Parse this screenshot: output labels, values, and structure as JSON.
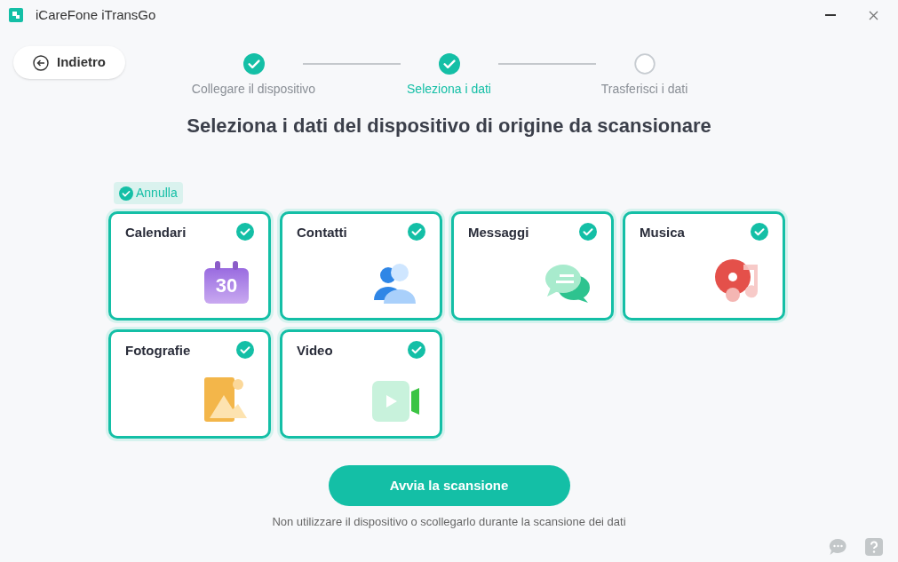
{
  "window": {
    "title": "iCareFone iTransGo"
  },
  "back_button": {
    "label": "Indietro"
  },
  "steps": [
    {
      "label": "Collegare il dispositivo",
      "done": true,
      "selected": false
    },
    {
      "label": "Seleziona i dati",
      "done": true,
      "selected": true
    },
    {
      "label": "Trasferisci i dati",
      "done": false,
      "selected": false
    }
  ],
  "heading": "Seleziona i dati del dispositivo di origine da scansionare",
  "toggle_all": {
    "label": "Annulla",
    "checked": true
  },
  "categories": [
    {
      "label": "Calendari",
      "kind": "calendar",
      "checked": true,
      "icon_text": "30"
    },
    {
      "label": "Contatti",
      "kind": "contacts",
      "checked": true
    },
    {
      "label": "Messaggi",
      "kind": "messages",
      "checked": true
    },
    {
      "label": "Musica",
      "kind": "music",
      "checked": true
    },
    {
      "label": "Fotografie",
      "kind": "photos",
      "checked": true
    },
    {
      "label": "Video",
      "kind": "video",
      "checked": true
    }
  ],
  "scan_button": {
    "label": "Avvia la scansione"
  },
  "note": "Non utilizzare il dispositivo o scollegarlo durante la scansione dei dati"
}
